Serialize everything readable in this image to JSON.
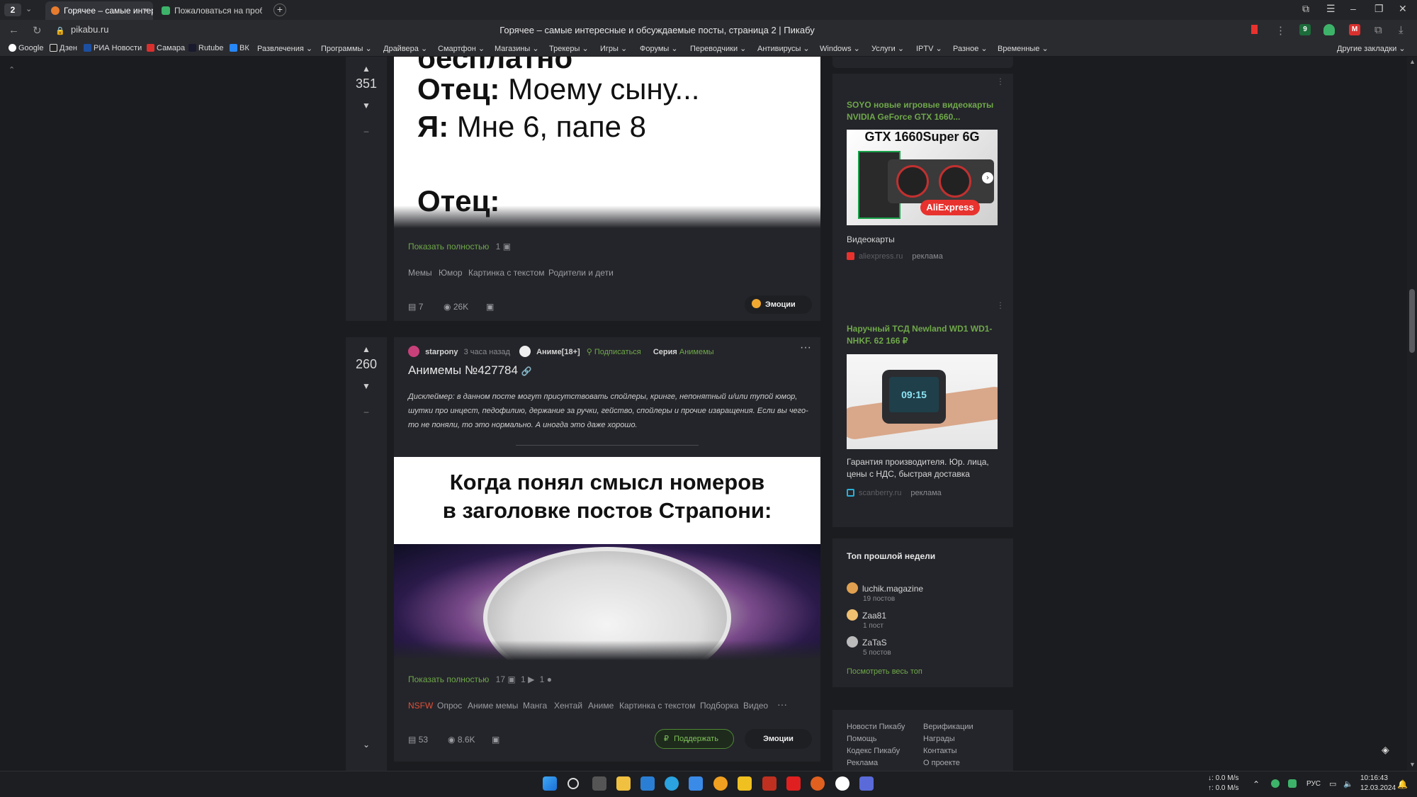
{
  "browser": {
    "tab_count": "2",
    "tabs": [
      {
        "title": "Горячее – самые интер"
      },
      {
        "title": "Пожаловаться на пробле"
      }
    ],
    "url": "pikabu.ru",
    "page_title": "Горячее – самые интересные и обсуждаемые посты, страница 2 | Пикабу",
    "bookmarks": [
      "Google",
      "Дзен",
      "РИА Новости",
      "Самара",
      "Rutube",
      "ВК",
      "Развлечения",
      "Программы",
      "Драйвера",
      "Смартфон",
      "Магазины",
      "Трекеры",
      "Игры",
      "Форумы",
      "Переводчики",
      "Антивирусы",
      "Windows",
      "Услуги",
      "IPTV",
      "Разное",
      "Временные"
    ],
    "other_bookmarks": "Другие закладки",
    "colors": {
      "accent_green": "#6fa84a",
      "background": "#1b1c1f",
      "card": "#24252a"
    }
  },
  "post1": {
    "rating": "351",
    "meme_lines": [
      "бесплатно",
      "Отец:",
      " Моему сыну...",
      "Я:",
      " Мне 6, папе 8",
      "Отец:"
    ],
    "show_full": "Показать полностью",
    "photo_count": "1",
    "tags": [
      "Мемы",
      "Юмор",
      "Картинка с текстом",
      "Родители и дети"
    ],
    "comments": "7",
    "views": "26K",
    "emotions": "Эмоции"
  },
  "post2": {
    "rating": "260",
    "author": "starpony",
    "time": "3 часа назад",
    "community": "Аниме[18+]",
    "subscribe": "Подписаться",
    "series_label": "Серия",
    "series_name": "Анимемы",
    "title": "Анимемы №427784",
    "disclaimer": "Дисклеймер: в данном посте могут присутствовать спойлеры, кринге, непонятный и/или тупой юмор, шутки про инцест, педофилию, держание за ручки, гейство, спойлеры и прочие извращения. Если вы чего-то не поняли, то это нормально. А иногда это даже хорошо.",
    "meme_caption_1": "Когда понял смысл номеров",
    "meme_caption_2": "в заголовке постов Страпони:",
    "show_full": "Показать полностью",
    "photos": "17",
    "videos": "1",
    "gifs": "1",
    "tags": [
      "NSFW",
      "Опрос",
      "Аниме мемы",
      "Манга",
      "Хентай",
      "Аниме",
      "Картинка с текстом",
      "Подборка",
      "Видео"
    ],
    "comments": "53",
    "views": "8.6K",
    "support": "Поддержать",
    "emotions": "Эмоции"
  },
  "sidebar": {
    "ad1": {
      "title": "SOYO новые игровые видеокарты NVIDIA GeForce GTX 1660...",
      "image_text": "GTX 1660Super 6G",
      "image_badge": "AliExpress",
      "label": "Видеокарты",
      "source": "aliexpress.ru",
      "ad_mark": "реклама"
    },
    "ad2": {
      "title": "Наручный ТСД Newland WD1 WD1-NHKF. 62 166 ₽",
      "image_text": "09:15",
      "label": "Гарантия производителя. Юр. лица, цены с НДС, быстрая доставка",
      "source": "scanberry.ru",
      "ad_mark": "реклама"
    },
    "top_title": "Топ прошлой недели",
    "top_users": [
      {
        "name": "luchik.magazine",
        "posts": "19 постов"
      },
      {
        "name": "Zaa81",
        "posts": "1 пост"
      },
      {
        "name": "ZaTaS",
        "posts": "5 постов"
      }
    ],
    "see_all": "Посмотреть весь топ",
    "footer_left": [
      "Новости Пикабу",
      "Помощь",
      "Кодекс Пикабу",
      "Реклама"
    ],
    "footer_right": [
      "Верификации",
      "Награды",
      "Контакты",
      "О проекте"
    ]
  },
  "taskbar": {
    "net_down": "0.0 M/s",
    "net_up": "0.0 M/s",
    "lang": "РУС",
    "time": "10:16:43",
    "date": "12.03.2024"
  }
}
